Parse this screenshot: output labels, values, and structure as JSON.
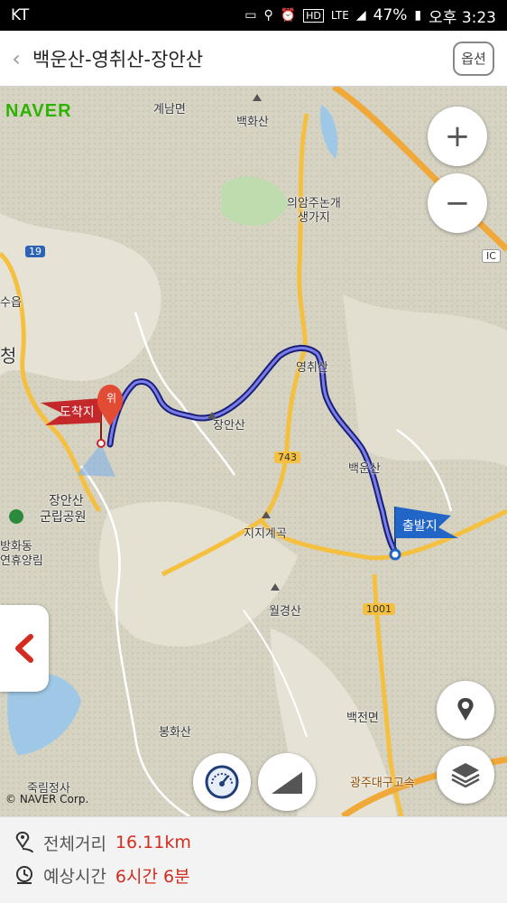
{
  "status": {
    "carrier": "KT",
    "battery": "47%",
    "time": "오후 3:23",
    "lte": "LTE",
    "hd": "HD"
  },
  "header": {
    "title": "백운산-영취산-장안산",
    "option_label": "옵션"
  },
  "map": {
    "brand": "NAVER",
    "copyright": "© NAVER Corp.",
    "labels": {
      "gyenam": "계남면",
      "baekhwa": "백화산",
      "uiam1": "의암주논개",
      "uiam2": "생가지",
      "yeongchwi": "영취산",
      "jangan": "장안산",
      "baekun": "백운산",
      "jangan_park1": "장안산",
      "jangan_park2": "군립공원",
      "jiji": "지지계곡",
      "wolgyeong": "월경산",
      "baekjeon": "백전면",
      "bonghwa": "봉화산",
      "jukrim": "죽림정사",
      "banghwa1": "방화동",
      "banghwa2": "연휴양림",
      "cheong": "청",
      "su": "수읍",
      "highway": "광주대구고속",
      "road19": "19",
      "road743": "743",
      "road1001": "1001",
      "ic": "IC"
    },
    "flags": {
      "arrival": "도착지",
      "departure": "출발지",
      "waypoint": "위"
    }
  },
  "summary": {
    "distance_label": "전체거리",
    "distance_value": "16.11km",
    "time_label": "예상시간",
    "time_value": "6시간 6분"
  },
  "colors": {
    "route": "#2b2fb8",
    "arrival_flag": "#c5282a",
    "departure_flag": "#2166c7",
    "value_text": "#d32c1f"
  }
}
